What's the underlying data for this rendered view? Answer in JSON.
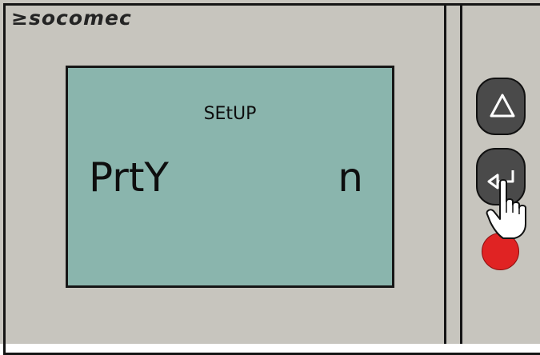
{
  "brand": {
    "logo_text": "≥socomec"
  },
  "display": {
    "title": "SEtUP",
    "parameter": "PrtY",
    "value": "n"
  },
  "controls": {
    "up_button_icon": "triangle-up-icon",
    "enter_button_icon": "enter-return-icon",
    "status_led_color": "#e02323"
  },
  "colors": {
    "panel": "#c7c5be",
    "lcd_background": "#8ab5ad",
    "button": "#4a4a4a",
    "frame": "#151515"
  }
}
